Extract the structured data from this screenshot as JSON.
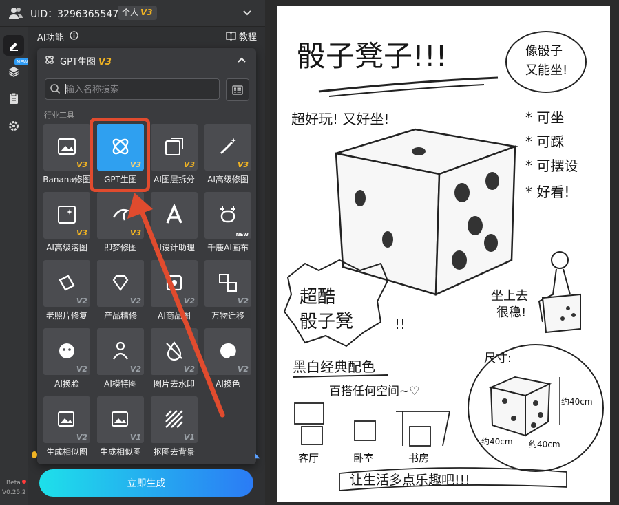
{
  "header": {
    "uid_text": "UID：3296365547",
    "account_type": "个人",
    "account_level": "V3"
  },
  "sidebar": {
    "items": [
      "edit-icon",
      "layers-icon",
      "clipboard-icon",
      "settings-icon"
    ],
    "new_tag": "NEW",
    "beta": "Beta",
    "version": "V0.25.2"
  },
  "panel": {
    "ai_title": "AI功能",
    "tutorial": "教程",
    "section_title": "GPT生图",
    "section_level": "V3",
    "search_placeholder": "输入名称搜索",
    "category": "行业工具",
    "generate_label": "立即生成",
    "tools": [
      {
        "label": "Banana修图",
        "ver": "V3",
        "icon": "image-edit-icon"
      },
      {
        "label": "GPT生图",
        "ver": "V3",
        "icon": "gpt-icon"
      },
      {
        "label": "AI图层拆分",
        "ver": "V3",
        "icon": "layer-split-icon"
      },
      {
        "label": "AI高级修图",
        "ver": "V3",
        "icon": "magic-wand-icon"
      },
      {
        "label": "AI高级溶图",
        "ver": "V3",
        "icon": "blend-icon"
      },
      {
        "label": "即梦修图",
        "ver": "V3",
        "icon": "dream-icon"
      },
      {
        "label": "AI设计助理",
        "ver": "",
        "icon": "design-assist-icon"
      },
      {
        "label": "千鹿AI画布",
        "ver": "NEW",
        "icon": "deer-icon"
      },
      {
        "label": "老照片修复",
        "ver": "V2",
        "icon": "photo-repair-icon"
      },
      {
        "label": "产品精修",
        "ver": "V2",
        "icon": "gem-icon"
      },
      {
        "label": "AI商品图",
        "ver": "V2",
        "icon": "product-icon"
      },
      {
        "label": "万物迁移",
        "ver": "V2",
        "icon": "migrate-icon"
      },
      {
        "label": "AI换脸",
        "ver": "V2",
        "icon": "face-icon"
      },
      {
        "label": "AI模特图",
        "ver": "V2",
        "icon": "model-icon"
      },
      {
        "label": "图片去水印",
        "ver": "V2",
        "icon": "watermark-remove-icon"
      },
      {
        "label": "AI换色",
        "ver": "V2",
        "icon": "palette-icon"
      },
      {
        "label": "生成相似图",
        "ver": "V2",
        "icon": "similar-icon"
      },
      {
        "label": "生成相似图",
        "ver": "V1",
        "icon": "similar-icon-2"
      },
      {
        "label": "抠图去背景",
        "ver": "V1",
        "icon": "cutout-icon"
      }
    ]
  },
  "artwork": {
    "title": "骰子凳子!!!",
    "bubble": [
      "像骰子",
      "又能坐!"
    ],
    "fun_line": "超好玩! 又好坐!",
    "features": [
      "可坐",
      "可踩",
      "可摆设",
      "好看!"
    ],
    "cool_burst": [
      "超酷",
      "骰子凳"
    ],
    "sit_note": [
      "坐上去",
      "很稳!"
    ],
    "color_title": "黑白经典配色",
    "match_line": "百搭任何空间~♡",
    "size_title": "尺寸:",
    "dim_height": "约40cm",
    "dim_width": "约40cm",
    "dim_depth": "约40cm",
    "rooms": [
      "客厅",
      "卧室",
      "书房"
    ],
    "banner": "让生活多点乐趣吧!!!",
    "exclaim": "!!"
  }
}
